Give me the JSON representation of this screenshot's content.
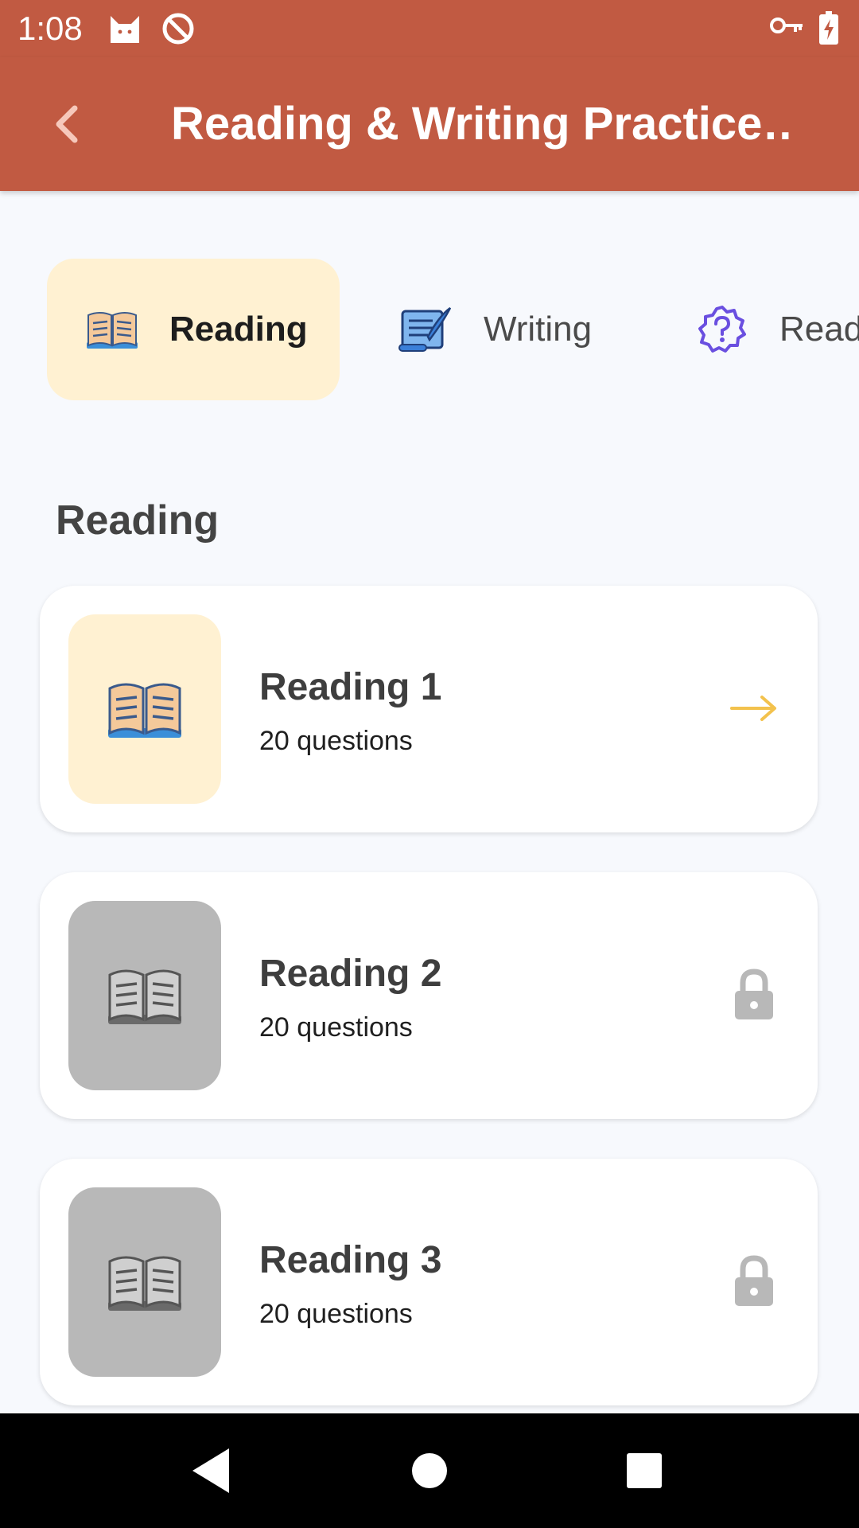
{
  "status_bar": {
    "time": "1:08",
    "icons": [
      "cat-icon",
      "do-not-disturb-icon",
      "vpn-key-icon",
      "battery-charging-icon"
    ]
  },
  "app_bar": {
    "title": "Reading & Writing Practice…",
    "back_icon": "chevron-left-icon",
    "background": "#c15a42"
  },
  "tabs": [
    {
      "label": "Reading",
      "icon": "open-book-icon",
      "active": true
    },
    {
      "label": "Writing",
      "icon": "scroll-quill-icon",
      "active": false
    },
    {
      "label": "Read",
      "icon": "question-badge-icon",
      "active": false
    }
  ],
  "section": {
    "title": "Reading",
    "items": [
      {
        "title": "Reading 1",
        "subtitle": "20 questions",
        "locked": false,
        "action_icon": "arrow-right-icon"
      },
      {
        "title": "Reading 2",
        "subtitle": "20 questions",
        "locked": true,
        "action_icon": "lock-icon"
      },
      {
        "title": "Reading 3",
        "subtitle": "20 questions",
        "locked": true,
        "action_icon": "lock-icon"
      }
    ]
  },
  "colors": {
    "accent": "#c15a42",
    "active_tab_bg": "#fff1d2",
    "arrow": "#f3c24d",
    "locked": "#b8b8b8"
  },
  "nav_bar": {
    "buttons": [
      "back-triangle-icon",
      "home-circle-icon",
      "recents-square-icon"
    ]
  }
}
